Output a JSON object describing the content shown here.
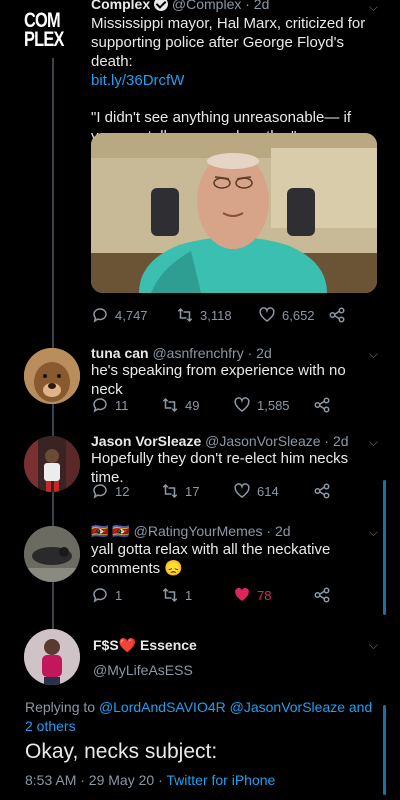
{
  "tweet1": {
    "avatar_text": "COM\nPLEX",
    "name": "Complex",
    "handle": "@Complex",
    "time": "· 2d",
    "text": "Mississippi mayor, Hal Marx, criticized for supporting police after George Floyd's death:",
    "link": "bit.ly/36DrcfW",
    "quote": "\"I didn't see anything unreasonable— if you can talk, you can breathe.\"",
    "replies": "4,747",
    "retweets": "3,118",
    "likes": "6,652"
  },
  "tweet2": {
    "name": "tuna can",
    "handle": "@asnfrenchfry",
    "time": "· 2d",
    "text": "he's speaking from experience with no neck",
    "replies": "11",
    "retweets": "49",
    "likes": "1,585"
  },
  "tweet3": {
    "name": "Jason VorSleaze",
    "handle": "@JasonVorSleaze",
    "time": "· 2d",
    "text": "Hopefully they don't re-elect him necks time.",
    "replies": "12",
    "retweets": "17",
    "likes": "614"
  },
  "tweet4": {
    "name": "🇸🇿 🇸🇿",
    "handle": "@RatingYourMemes",
    "time": "· 2d",
    "text": "yall gotta relax with all the neckative comments",
    "emoji": "😞",
    "replies": "1",
    "retweets": "1",
    "likes": "78"
  },
  "main": {
    "name_prefix": "F$S",
    "name_heart": "❤️",
    "name_suffix": "Essence",
    "handle": "@MyLifeAsESS",
    "replying_prefix": "Replying to",
    "replying_to": "@LordAndSAVIO4R @JasonVorSleaze and 2 others",
    "text": "Okay, necks subject:",
    "time": "8:53 AM · 29 May 20 ·",
    "source": "Twitter for iPhone"
  },
  "colors": {
    "link": "#1da1f2",
    "like_active": "#e0245e",
    "muted": "#8b98a5"
  }
}
